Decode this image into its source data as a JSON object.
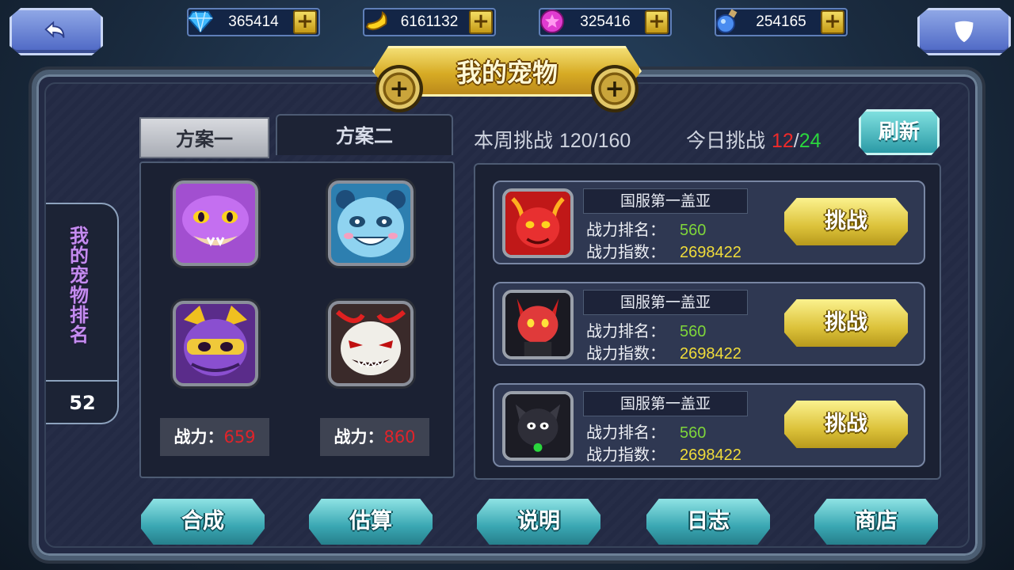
{
  "currencies": [
    {
      "icon": "diamond-icon",
      "value": "365414"
    },
    {
      "icon": "banana-icon",
      "value": "6161132"
    },
    {
      "icon": "star-coin-icon",
      "value": "325416"
    },
    {
      "icon": "potion-icon",
      "value": "254165"
    }
  ],
  "title": "我的宠物",
  "side": {
    "title": "我的宠物排名",
    "rank": "52"
  },
  "plans": {
    "plan1": "方案一",
    "plan2": "方案二"
  },
  "pets": [
    {
      "name": "purple-snake-pet"
    },
    {
      "name": "blue-panda-pet"
    },
    {
      "name": "purple-ninja-cat-pet"
    },
    {
      "name": "shadow-demon-pet"
    }
  ],
  "powers": [
    {
      "label": "战力：",
      "value": "659"
    },
    {
      "label": "战力：",
      "value": "860"
    }
  ],
  "stats": {
    "weekly_label": "本周挑战",
    "weekly_value": "120/160",
    "daily_label": "今日挑战",
    "daily_used": "12",
    "daily_sep": "/",
    "daily_total": "24"
  },
  "refresh_label": "刷新",
  "opponents": [
    {
      "name": "国服第一盖亚",
      "rank_label": "战力排名：",
      "rank": "560",
      "power_label": "战力指数：",
      "power": "2698422",
      "button": "挑战"
    },
    {
      "name": "国服第一盖亚",
      "rank_label": "战力排名：",
      "rank": "560",
      "power_label": "战力指数：",
      "power": "2698422",
      "button": "挑战"
    },
    {
      "name": "国服第一盖亚",
      "rank_label": "战力排名：",
      "rank": "560",
      "power_label": "战力指数：",
      "power": "2698422",
      "button": "挑战"
    }
  ],
  "bottom": [
    "合成",
    "估算",
    "说明",
    "日志",
    "商店"
  ],
  "colors": {
    "accent_gold": "#d7ab24",
    "teal": "#3aa7b3",
    "power_red": "#e0232a",
    "rank_green": "#7fd63a",
    "power_yellow": "#f0dc3a"
  }
}
